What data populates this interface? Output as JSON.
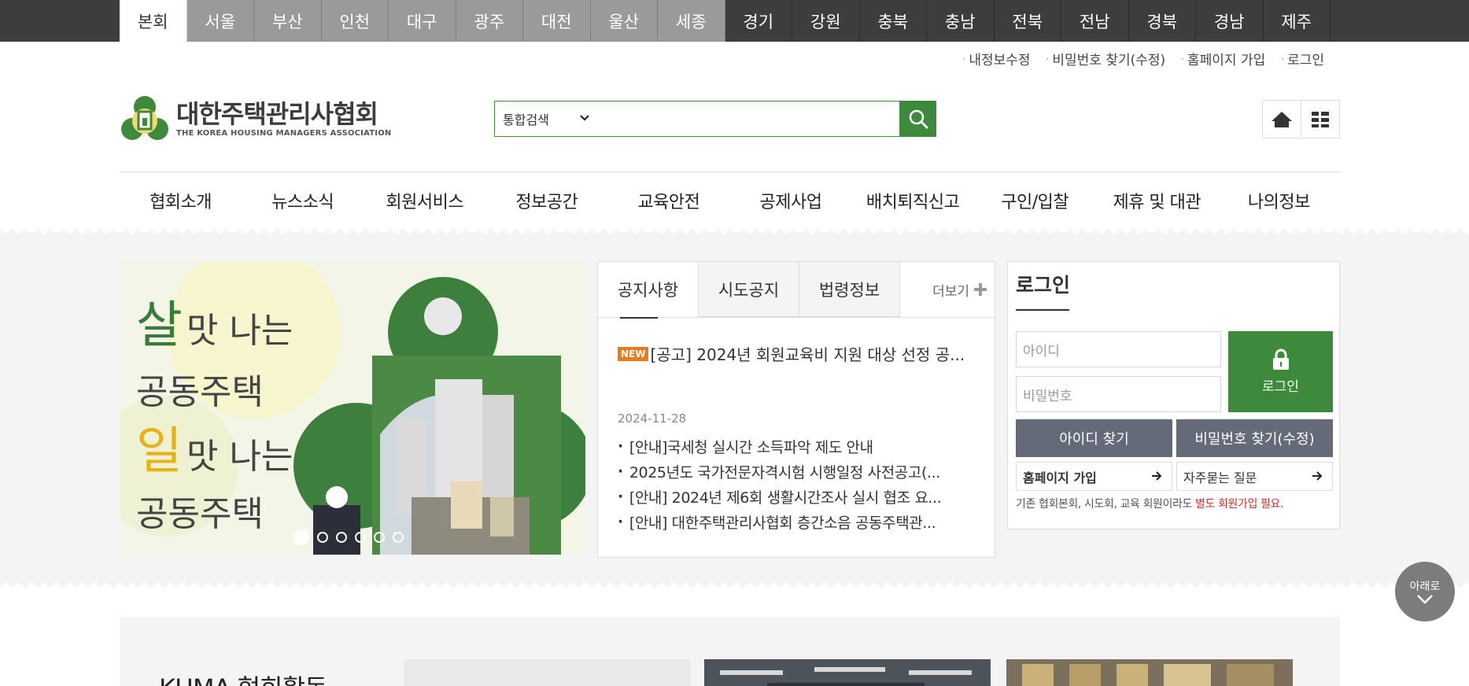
{
  "regions": {
    "items": [
      "본회",
      "서울",
      "부산",
      "인천",
      "대구",
      "광주",
      "대전",
      "울산",
      "세종",
      "경기",
      "강원",
      "충북",
      "충남",
      "전북",
      "전남",
      "경북",
      "경남",
      "제주"
    ],
    "active_index": 0,
    "light_count": 8
  },
  "util_links": [
    "내정보수정",
    "비밀번호 찾기(수정)",
    "홈페이지 가입",
    "로그인"
  ],
  "logo": {
    "title": "대한주택관리사협회",
    "subtitle": "THE KOREA HOUSING MANAGERS ASSOCIATION"
  },
  "search": {
    "select_label": "통합검색",
    "value": ""
  },
  "gnb": [
    "협회소개",
    "뉴스소식",
    "회원서비스",
    "정보공간",
    "교육안전",
    "공제사업",
    "배치퇴직신고",
    "구인/입찰",
    "제휴 및 대관",
    "나의정보"
  ],
  "banner": {
    "line1_big": "살",
    "line1_rest": "맛 나는",
    "line2": "공동주택",
    "line3_big": "일",
    "line3_rest": "맛 나는",
    "line4": "공동주택",
    "slide_count": 6,
    "active_slide": 0
  },
  "notice": {
    "tabs": [
      "공지사항",
      "시도공지",
      "법령정보"
    ],
    "more_label": "더보기",
    "badge": "NEW",
    "first_title": "[공고] 2024년 회원교육비 지원 대상 선정 공...",
    "date": "2024-11-28",
    "items": [
      "[안내]국세청 실시간 소득파악 제도 안내",
      "2025년도 국가전문자격시험 시행일정 사전공고(...",
      "[안내] 2024년 제6회 생활시간조사 실시 협조 요...",
      "[안내] 대한주택관리사협회 층간소음 공동주택관..."
    ]
  },
  "login": {
    "title": "로그인",
    "id_placeholder": "아이디",
    "pw_placeholder": "비밀번호",
    "login_button": "로그인",
    "find_id": "아이디 찾기",
    "find_pw": "비밀번호 찾기(수정)",
    "join": "홈페이지 가입",
    "faq": "자주묻는 질문",
    "note_prefix": "기존 협회본회, 시도회, 교육 회원이라도 ",
    "note_red": "별도 회원가입 필요."
  },
  "scroll_down": "아래로",
  "lower": {
    "title": "KHMA 협회활동"
  },
  "colors": {
    "brand_green": "#3d8a3c",
    "dark_bar": "#3d3d3d",
    "gray_button": "#656a78",
    "new_badge": "#e87b1c",
    "note_red": "#c9302c"
  }
}
